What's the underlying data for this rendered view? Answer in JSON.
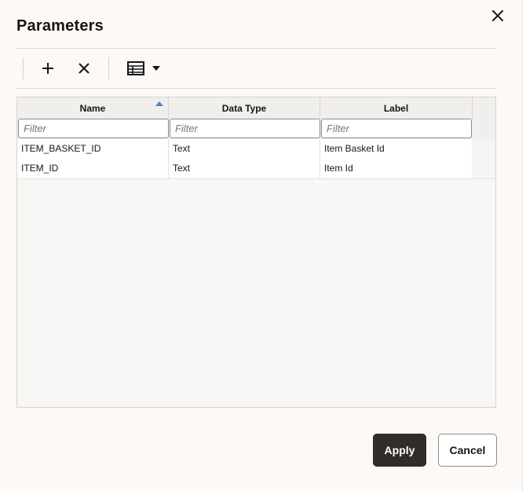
{
  "dialog": {
    "title": "Parameters",
    "close_icon": "close-icon"
  },
  "toolbar": {
    "add_icon": "plus-icon",
    "delete_icon": "x-icon",
    "view_icon": "table-view-icon",
    "view_dropdown_icon": "caret-down-icon"
  },
  "table": {
    "columns": [
      {
        "label": "Name",
        "sorted": "ascending"
      },
      {
        "label": "Data Type"
      },
      {
        "label": "Label"
      }
    ],
    "filter_placeholders": [
      "Filter",
      "Filter",
      "Filter"
    ],
    "rows": [
      {
        "name": "ITEM_BASKET_ID",
        "data_type": "Text",
        "label": "Item Basket Id"
      },
      {
        "name": "ITEM_ID",
        "data_type": "Text",
        "label": "Item Id"
      }
    ]
  },
  "footer": {
    "apply_label": "Apply",
    "cancel_label": "Cancel"
  },
  "colors": {
    "background": "#fcf9f6",
    "primary_button": "#312d2a",
    "sort_indicator": "#4a86c5"
  }
}
